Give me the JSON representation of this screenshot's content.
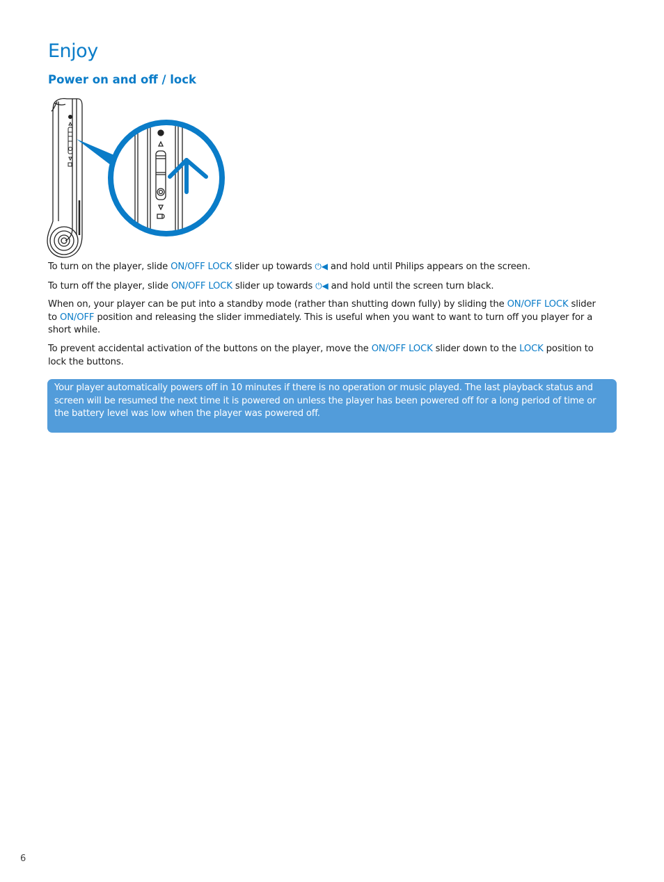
{
  "page": {
    "title": "Enjoy",
    "section_title": "Power on and off / lock",
    "page_number": "6"
  },
  "colors": {
    "accent": "#0a7cc8",
    "note_background": "#529cda",
    "note_text": "#ffffff"
  },
  "illustration": {
    "description": "player-side-view-with-magnified-on-off-lock-slider",
    "arrow_direction": "up"
  },
  "paragraphs": {
    "p1": {
      "a": "To turn on the player, slide ",
      "b": "ON/OFF LOCK",
      "c": " slider up towards ",
      "icon": "power-icon",
      "d": " and hold until Philips appears on the screen."
    },
    "p2": {
      "a": "To turn off the player, slide ",
      "b": "ON/OFF LOCK",
      "c": " slider up towards ",
      "icon": "power-icon",
      "d": " and hold until the screen turn black."
    },
    "p3": {
      "a": "When on, your player can be put into a standby mode (rather than shutting down fully) by sliding the ",
      "b": "ON/OFF LOCK",
      "c": " slider to ",
      "d": "ON/OFF",
      "e": " position and releasing the slider immediately. This is useful when you want to want to turn off you player for a short while."
    },
    "p4": {
      "a": "To prevent accidental activation of the buttons on the player, move the ",
      "b": "ON/OFF LOCK",
      "c": " slider down to the ",
      "d": "LOCK",
      "e": " position to lock the buttons."
    }
  },
  "note": {
    "text": "Your player automatically powers off in 10 minutes if there is no operation or music played. The last playback status and screen will be resumed the next time it is powered on unless the player has been powered off for a long period of time or the battery level was low when the player was powered off."
  }
}
